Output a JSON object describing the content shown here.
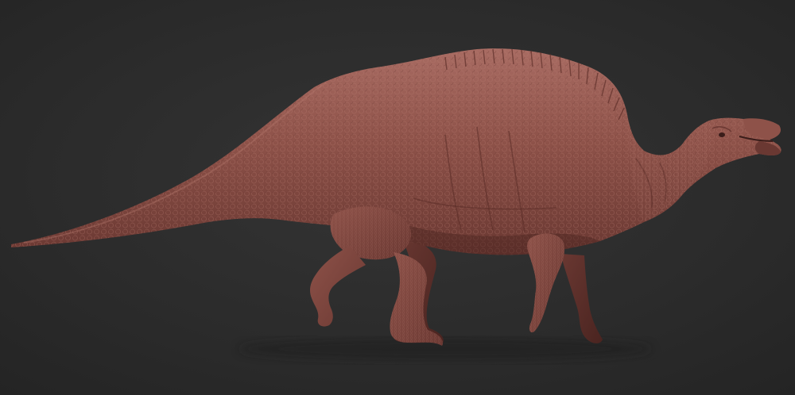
{
  "scene": {
    "subject": "dinosaur-sculpt",
    "colors": {
      "background_top": "#343434",
      "background_mid": "#2b2b2b",
      "background_bottom": "#242424",
      "skin_light": "#a86b62",
      "skin_mid": "#8e5249",
      "skin_dark": "#6a3832",
      "skin_shadow": "#4a2420",
      "scale_highlight": "#b87a70",
      "eye": "#3a1d1a"
    }
  }
}
